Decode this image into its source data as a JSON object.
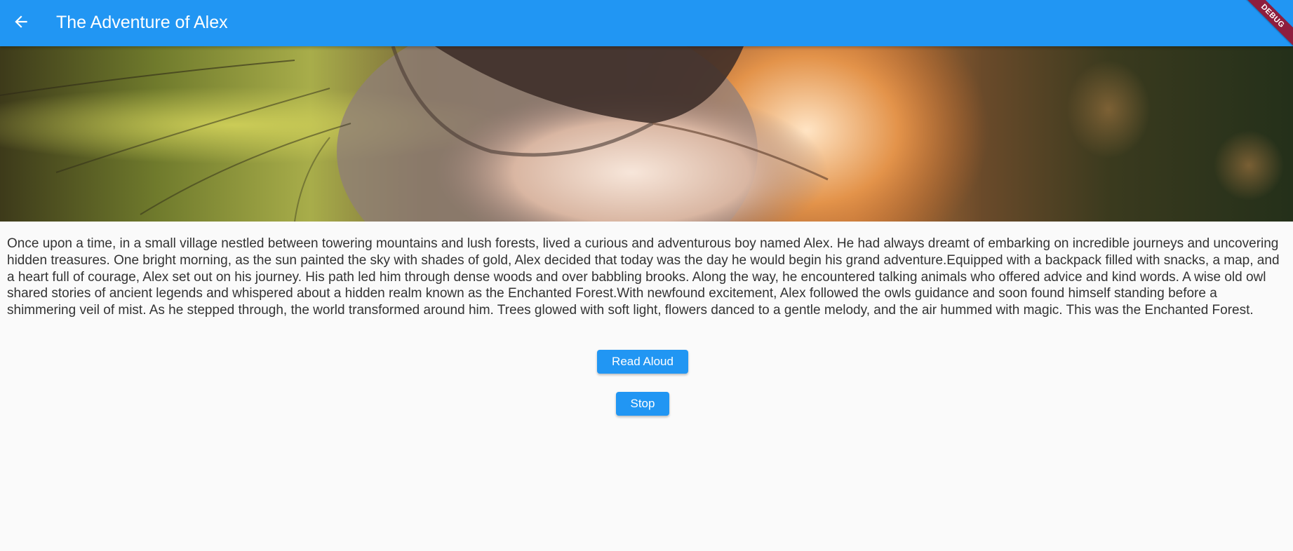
{
  "appbar": {
    "title": "The Adventure of Alex",
    "back_icon": "arrow-back-icon",
    "color": "#2196f3"
  },
  "debug_banner": {
    "label": "DEBUG",
    "color": "#8e1e3e"
  },
  "hero_image": {
    "subject": "close-up of a fox muzzle in a forest"
  },
  "story": {
    "text": "Once upon a time, in a small village nestled between towering mountains and lush forests, lived a curious and adventurous boy named Alex. He had always dreamt of embarking on incredible journeys and uncovering hidden treasures. One bright morning, as the sun painted the sky with shades of gold, Alex decided that today was the day he would begin his grand adventure.Equipped with a backpack filled with snacks, a map, and a heart full of courage, Alex set out on his journey. His path led him through dense woods and over babbling brooks. Along the way, he encountered talking animals who offered advice and kind words. A wise old owl shared stories of ancient legends and whispered about a hidden realm known as the Enchanted Forest.With newfound excitement, Alex followed the owls guidance and soon found himself standing before a shimmering veil of mist. As he stepped through, the world transformed around him. Trees glowed with soft light, flowers danced to a gentle melody, and the air hummed with magic. This was the Enchanted Forest."
  },
  "buttons": {
    "read_aloud": "Read Aloud",
    "stop": "Stop"
  }
}
